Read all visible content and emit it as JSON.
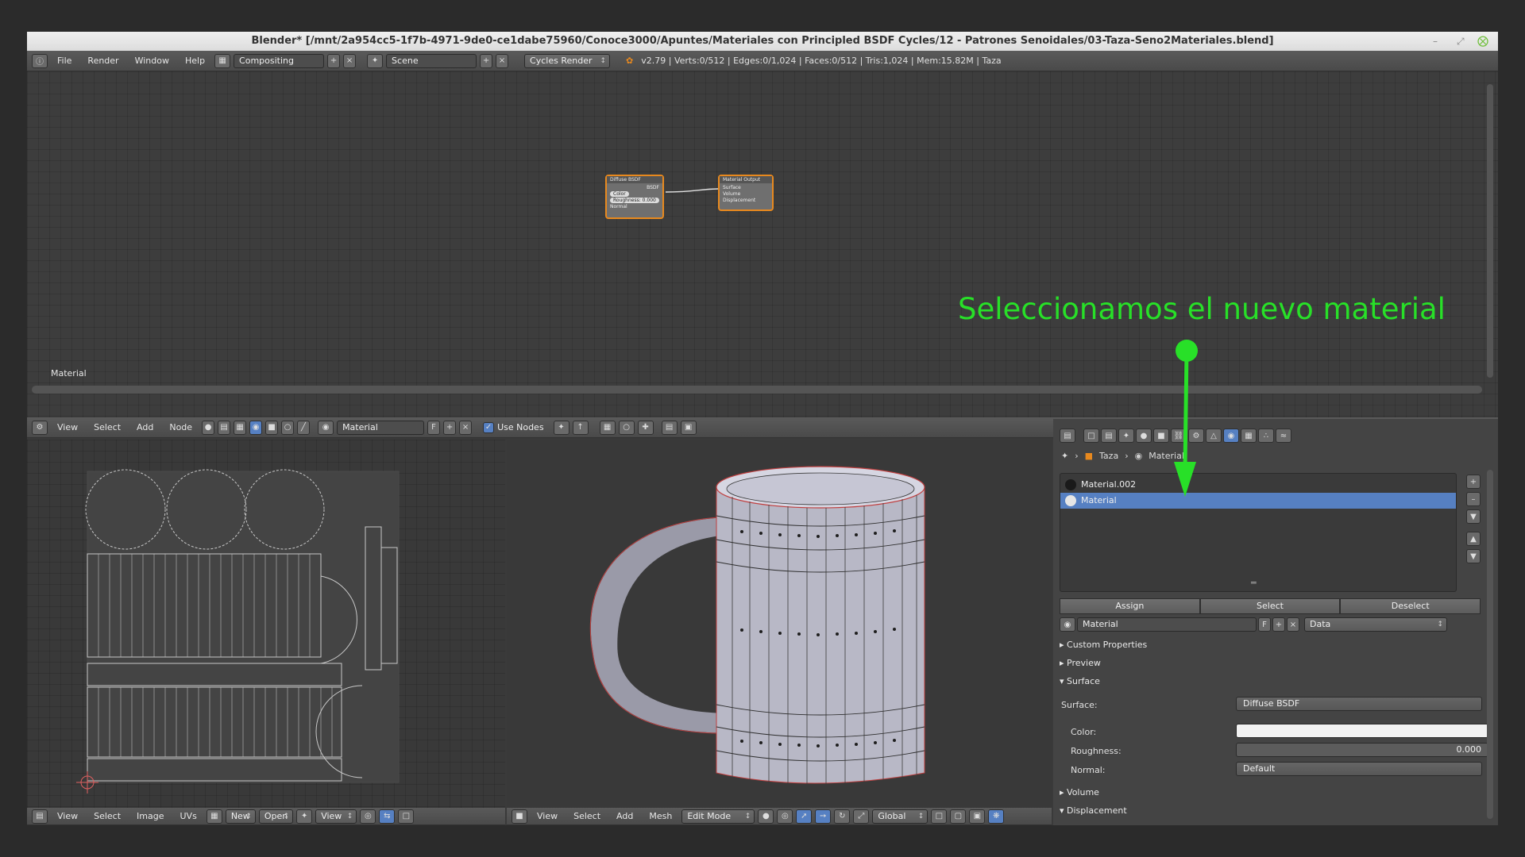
{
  "window": {
    "title": "Blender* [/mnt/2a954cc5-1f7b-4971-9de0-ce1dabe75960/Conoce3000/Apuntes/Materiales con Principled BSDF Cycles/12 - Patrones Senoidales/03-Taza-Seno2Materiales.blend]"
  },
  "top_header": {
    "menus": [
      "File",
      "Render",
      "Window",
      "Help"
    ],
    "layout": "Compositing",
    "scene": "Scene",
    "engine": "Cycles Render",
    "status": "v2.79 | Verts:0/512 | Edges:0/1,024 | Faces:0/512 | Tris:1,024 | Mem:15.82M | Taza"
  },
  "node_editor": {
    "label": "Material",
    "node_diffuse": {
      "title": "Diffuse BSDF",
      "out": "BSDF",
      "color": "Color",
      "roughness": "Roughness: 0.000",
      "normal": "Normal"
    },
    "node_output": {
      "title": "Material Output",
      "surface": "Surface",
      "volume": "Volume",
      "displacement": "Displacement"
    }
  },
  "node_header": {
    "menus": [
      "View",
      "Select",
      "Add",
      "Node"
    ],
    "material": "Material",
    "fake_user": "F",
    "use_nodes": "Use Nodes"
  },
  "uv_header": {
    "menus": [
      "View",
      "Select",
      "Image",
      "UVs"
    ],
    "new": "New",
    "open": "Open",
    "view": "View"
  },
  "view3d_header": {
    "menus": [
      "View",
      "Select",
      "Add",
      "Mesh"
    ],
    "mode": "Edit Mode",
    "orientation": "Global"
  },
  "properties": {
    "breadcrumb_object": "Taza",
    "breadcrumb_material": "Material",
    "materials": [
      {
        "name": "Material.002",
        "selected": false,
        "color": "#1a1a1a"
      },
      {
        "name": "Material",
        "selected": true,
        "color": "#e6e6e6"
      }
    ],
    "assign": "Assign",
    "select": "Select",
    "deselect": "Deselect",
    "material_field": "Material",
    "fake_user": "F",
    "link": "Data",
    "panels": {
      "custom_properties": "Custom Properties",
      "preview": "Preview",
      "surface": "Surface",
      "volume": "Volume",
      "displacement": "Displacement"
    },
    "surface_label": "Surface:",
    "surface_value": "Diffuse BSDF",
    "color_label": "Color:",
    "roughness_label": "Roughness:",
    "roughness_value": "0.000",
    "normal_label": "Normal:",
    "normal_value": "Default"
  },
  "annotation": "Seleccionamos el nuevo material",
  "colors": {
    "accent": "#5680c2",
    "annotation": "#28e028",
    "node_border": "#e8891e"
  }
}
